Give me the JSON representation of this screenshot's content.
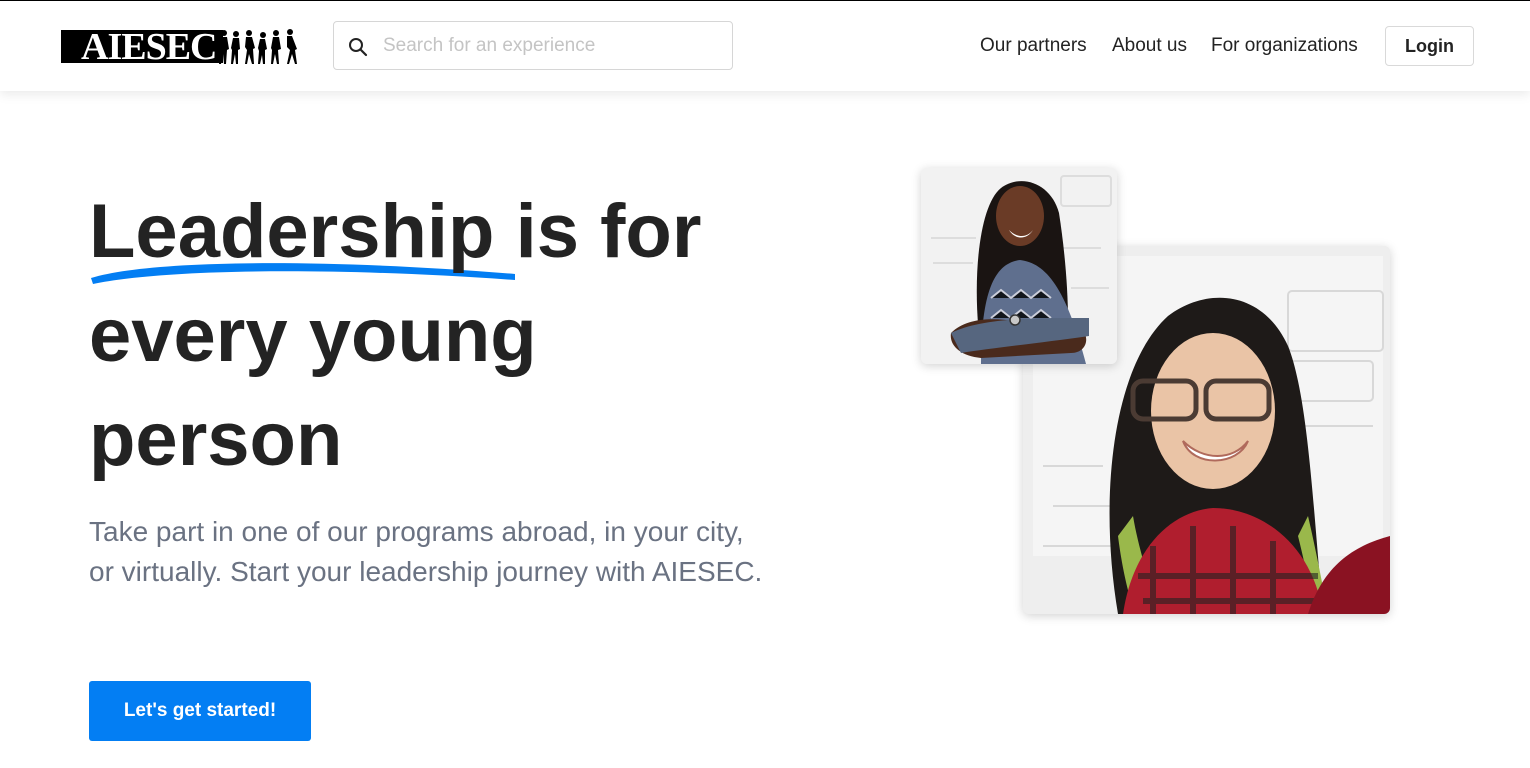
{
  "brand": {
    "logo_text": "AIESEC",
    "accent_color": "#037ef3"
  },
  "search": {
    "placeholder": "Search for an experience",
    "value": ""
  },
  "nav": {
    "partners": "Our partners",
    "about": "About us",
    "organizations": "For organizations",
    "login": "Login"
  },
  "hero": {
    "title_highlight": "Leadership",
    "title_line1_rest": " is for",
    "title_line2": "every young",
    "title_line3": "person",
    "subtitle": "Take part in one of our programs abroad, in your city, or virtually. Start your leadership journey with AIESEC.",
    "cta_label": "Let's get started!"
  },
  "icons": [
    "search-icon",
    "aiesec-logo"
  ]
}
